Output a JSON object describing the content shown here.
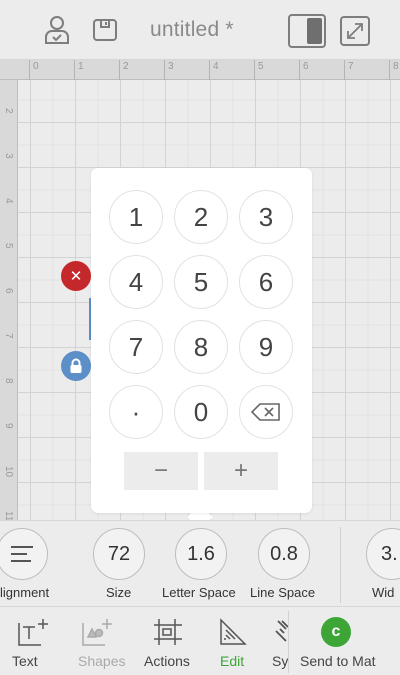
{
  "document": {
    "title": "untitled *"
  },
  "ruler": {
    "top_numbers": [
      "0",
      "1",
      "2",
      "3",
      "4",
      "5",
      "6",
      "7",
      "8"
    ],
    "left_numbers": [
      "2",
      "3",
      "4",
      "5",
      "6",
      "7",
      "8",
      "9",
      "10",
      "11"
    ]
  },
  "keypad": {
    "keys": [
      "1",
      "2",
      "3",
      "4",
      "5",
      "6",
      "7",
      "8",
      "9",
      "·",
      "0"
    ],
    "minus_label": "−",
    "plus_label": "+"
  },
  "text_tools": [
    {
      "label": "lignment",
      "value": ""
    },
    {
      "label": "Size",
      "value": "72"
    },
    {
      "label": "Letter Space",
      "value": "1.6"
    },
    {
      "label": "Line Space",
      "value": "0.8"
    },
    {
      "label": "Wid",
      "value": "3."
    }
  ],
  "bottom_nav": {
    "items": [
      {
        "label": "Text",
        "icon": "text-icon",
        "color": "#444444"
      },
      {
        "label": "Shapes",
        "icon": "shapes-icon",
        "color": "#aaaaaa"
      },
      {
        "label": "Actions",
        "icon": "actions-icon",
        "color": "#444444"
      },
      {
        "label": "Edit",
        "icon": "edit-icon",
        "color": "#3da535"
      },
      {
        "label": "Sy",
        "icon": "sync-icon",
        "color": "#444444"
      }
    ],
    "send": {
      "label": "Send to Mat",
      "glyph": "c",
      "color": "#3da535"
    }
  },
  "colors": {
    "delete": "#c4282b",
    "lock": "#5c8ec8",
    "accent": "#3da535"
  }
}
